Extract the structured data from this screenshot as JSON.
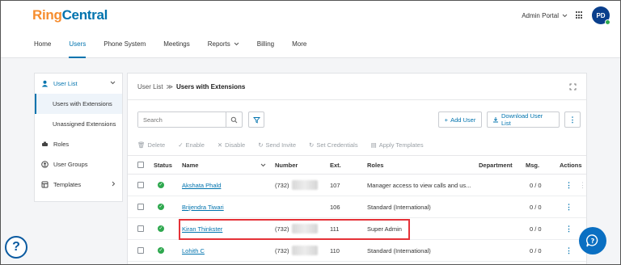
{
  "header": {
    "logo_ring": "Ring",
    "logo_central": "Central",
    "portal_label": "Admin Portal",
    "avatar_initials": "PD"
  },
  "nav": {
    "items": [
      {
        "label": "Home"
      },
      {
        "label": "Users"
      },
      {
        "label": "Phone System"
      },
      {
        "label": "Meetings"
      },
      {
        "label": "Reports"
      },
      {
        "label": "Billing"
      },
      {
        "label": "More"
      }
    ]
  },
  "sidebar": {
    "items": [
      {
        "label": "User List"
      },
      {
        "label": "Users with Extensions"
      },
      {
        "label": "Unassigned Extensions"
      },
      {
        "label": "Roles"
      },
      {
        "label": "User Groups"
      },
      {
        "label": "Templates"
      }
    ]
  },
  "breadcrumb": {
    "parent": "User List",
    "separator": "≫",
    "current": "Users with Extensions"
  },
  "toolbar": {
    "search_placeholder": "Search",
    "add_user": "Add User",
    "download": "Download User List"
  },
  "actions": {
    "delete": "Delete",
    "enable": "Enable",
    "disable": "Disable",
    "send_invite": "Send Invite",
    "set_credentials": "Set Credentials",
    "apply_templates": "Apply Templates"
  },
  "table": {
    "columns": {
      "status": "Status",
      "name": "Name",
      "number": "Number",
      "ext": "Ext.",
      "roles": "Roles",
      "department": "Department",
      "msg": "Msg.",
      "actions": "Actions"
    },
    "rows": [
      {
        "name": "Akshata Phald",
        "number": "(732)",
        "ext": "107",
        "role": "Manager access to view calls and us...",
        "msg": "0 / 0"
      },
      {
        "name": "Brijendra Tiwari",
        "number": "",
        "ext": "106",
        "role": "Standard (International)",
        "msg": "0 / 0"
      },
      {
        "name": "Kiran Thinkster",
        "number": "(732)",
        "ext": "111",
        "role": "Super Admin",
        "msg": "0 / 0"
      },
      {
        "name": "Lohith C",
        "number": "(732)",
        "ext": "110",
        "role": "Standard (International)",
        "msg": "0 / 0"
      }
    ]
  },
  "colors": {
    "brand_orange": "#f68d2e",
    "brand_blue": "#0073ae",
    "status_green": "#2ea84e",
    "highlight_red": "#e53238"
  }
}
